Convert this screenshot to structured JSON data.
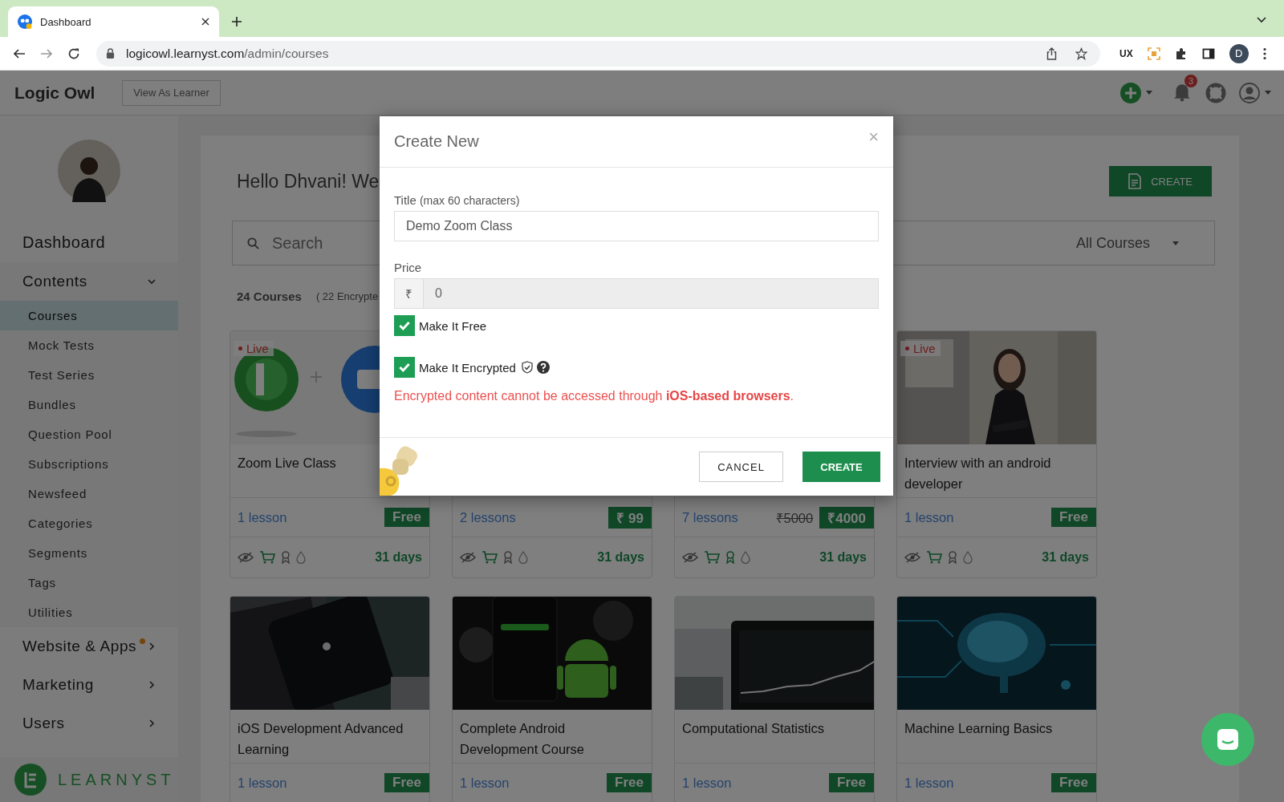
{
  "browser": {
    "tab_title": "Dashboard",
    "url_host": "logicowl.learnyst.com",
    "url_path": "/admin/courses",
    "ext_label": "UX",
    "profile_initial": "D"
  },
  "header": {
    "brand": "Logic Owl",
    "view_as_learner": "View As Learner",
    "notification_count": "3"
  },
  "sidebar": {
    "items": [
      {
        "label": "Dashboard",
        "kind": "link"
      },
      {
        "label": "Contents",
        "kind": "group",
        "expanded": true
      },
      {
        "label": "Courses",
        "kind": "sub",
        "selected": true
      },
      {
        "label": "Mock Tests",
        "kind": "sub",
        "selected": false
      },
      {
        "label": "Test Series",
        "kind": "sub",
        "selected": false
      },
      {
        "label": "Bundles",
        "kind": "sub",
        "selected": false
      },
      {
        "label": "Question Pool",
        "kind": "sub",
        "selected": false
      },
      {
        "label": "Subscriptions",
        "kind": "sub",
        "selected": false
      },
      {
        "label": "Newsfeed",
        "kind": "sub",
        "selected": false
      },
      {
        "label": "Categories",
        "kind": "sub",
        "selected": false
      },
      {
        "label": "Segments",
        "kind": "sub",
        "selected": false
      },
      {
        "label": "Tags",
        "kind": "sub",
        "selected": false
      },
      {
        "label": "Utilities",
        "kind": "sub",
        "selected": false
      },
      {
        "label": "Website & Apps",
        "kind": "group",
        "expanded": false,
        "dot": true
      },
      {
        "label": "Marketing",
        "kind": "group",
        "expanded": false
      },
      {
        "label": "Users",
        "kind": "group",
        "expanded": false
      }
    ],
    "footer_brand": "LEARNYST"
  },
  "main": {
    "greeting": "Hello Dhvani! We",
    "create_button": "CREATE",
    "search_placeholder": "Search",
    "filter": "All Courses",
    "course_count": "24 Courses",
    "encrypted_note": "( 22 Encrypte",
    "courses": [
      {
        "kind": "picture",
        "badge": "Live",
        "title": "Zoom Live Class",
        "lessons": "1 lesson",
        "price": "Free",
        "days": "31 days",
        "cart": true,
        "certificate": false
      },
      {
        "lessons": "2 lessons",
        "price": "₹ 99",
        "days": "31 days",
        "cart": true,
        "certificate": false
      },
      {
        "lessons": "7 lessons",
        "original_price": "₹5000",
        "price": "₹4000",
        "days": "31 days",
        "cart": true,
        "certificate": true
      },
      {
        "kind": "picture",
        "badge": "Live",
        "title": "Interview with an android developer",
        "lessons": "1 lesson",
        "price": "Free",
        "days": "31 days",
        "cart": true,
        "certificate": false
      },
      {
        "kind": "picture",
        "title": "iOS Development Advanced Learning",
        "lessons": "1 lesson",
        "price": "Free"
      },
      {
        "kind": "picture",
        "title": "Complete Android Development Course",
        "lessons": "1 lesson",
        "price": "Free"
      },
      {
        "kind": "picture",
        "title": "Computational Statistics",
        "lessons": "1 lesson",
        "price": "Free"
      },
      {
        "kind": "picture",
        "title": "Machine Learning Basics",
        "lessons": "1 lesson",
        "price": "Free"
      }
    ]
  },
  "modal": {
    "title": "Create New",
    "close": "×",
    "title_label": "Title",
    "title_hint": "(max 60 characters)",
    "title_value": "Demo Zoom Class",
    "price_label": "Price",
    "currency": "₹",
    "price_value": "0",
    "make_free": {
      "label": "Make It Free",
      "checked": true
    },
    "make_encrypted": {
      "label": "Make It Encrypted",
      "checked": true
    },
    "warning": "Encrypted content cannot be accessed through **iOS-based browsers**.",
    "cancel": "CANCEL",
    "create": "CREATE"
  }
}
